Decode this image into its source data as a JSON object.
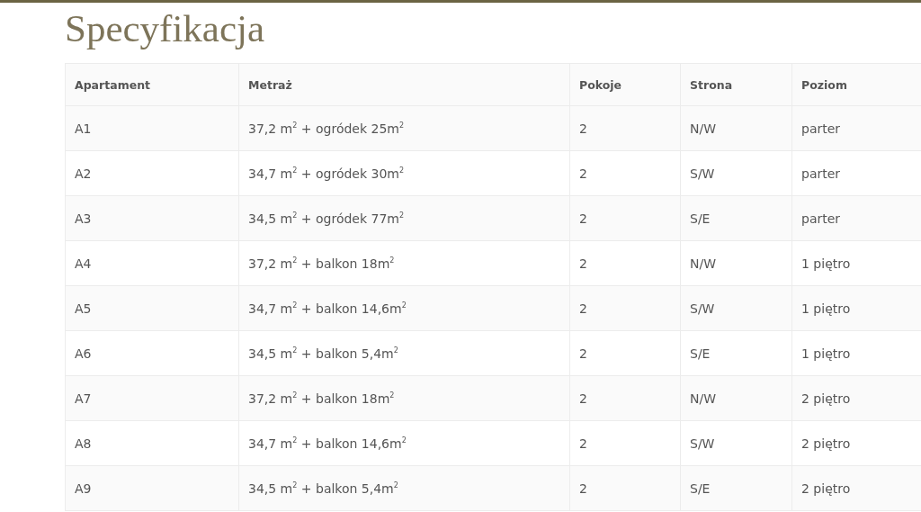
{
  "title": "Specyfikacja",
  "table": {
    "columns": [
      "Apartament",
      "Metraż",
      "Pokoje",
      "Strona",
      "Poziom"
    ],
    "rows": [
      [
        "A1",
        "37,2 m$^{2}$ + ogródek 25m$^{2}$",
        "2",
        "N/W",
        "parter"
      ],
      [
        "A2",
        "34,7 m$^{2}$ + ogródek 30m$^{2}$",
        "2",
        "S/W",
        "parter"
      ],
      [
        "A3",
        "34,5 m$^{2}$ + ogródek 77m$^{2}$",
        "2",
        "S/E",
        "parter"
      ],
      [
        "A4",
        "37,2 m$^{2}$ + balkon 18m$^{2}$",
        "2",
        "N/W",
        "1 piętro"
      ],
      [
        "A5",
        "34,7 m$^{2}$ + balkon 14,6m$^{2}$",
        "2",
        "S/W",
        "1 piętro"
      ],
      [
        "A6",
        "34,5 m$^{2}$ + balkon 5,4m$^{2}$",
        "2",
        "S/E",
        "1 piętro"
      ],
      [
        "A7",
        "37,2 m$^{2}$ + balkon 18m$^{2}$",
        "2",
        "N/W",
        "2 piętro"
      ],
      [
        "A8",
        "34,7 m$^{2}$ + balkon 14,6m$^{2}$",
        "2",
        "S/W",
        "2 piętro"
      ],
      [
        "A9",
        "34,5 m$^{2}$ + balkon 5,4m$^{2}$",
        "2",
        "S/E",
        "2 piętro"
      ]
    ]
  }
}
